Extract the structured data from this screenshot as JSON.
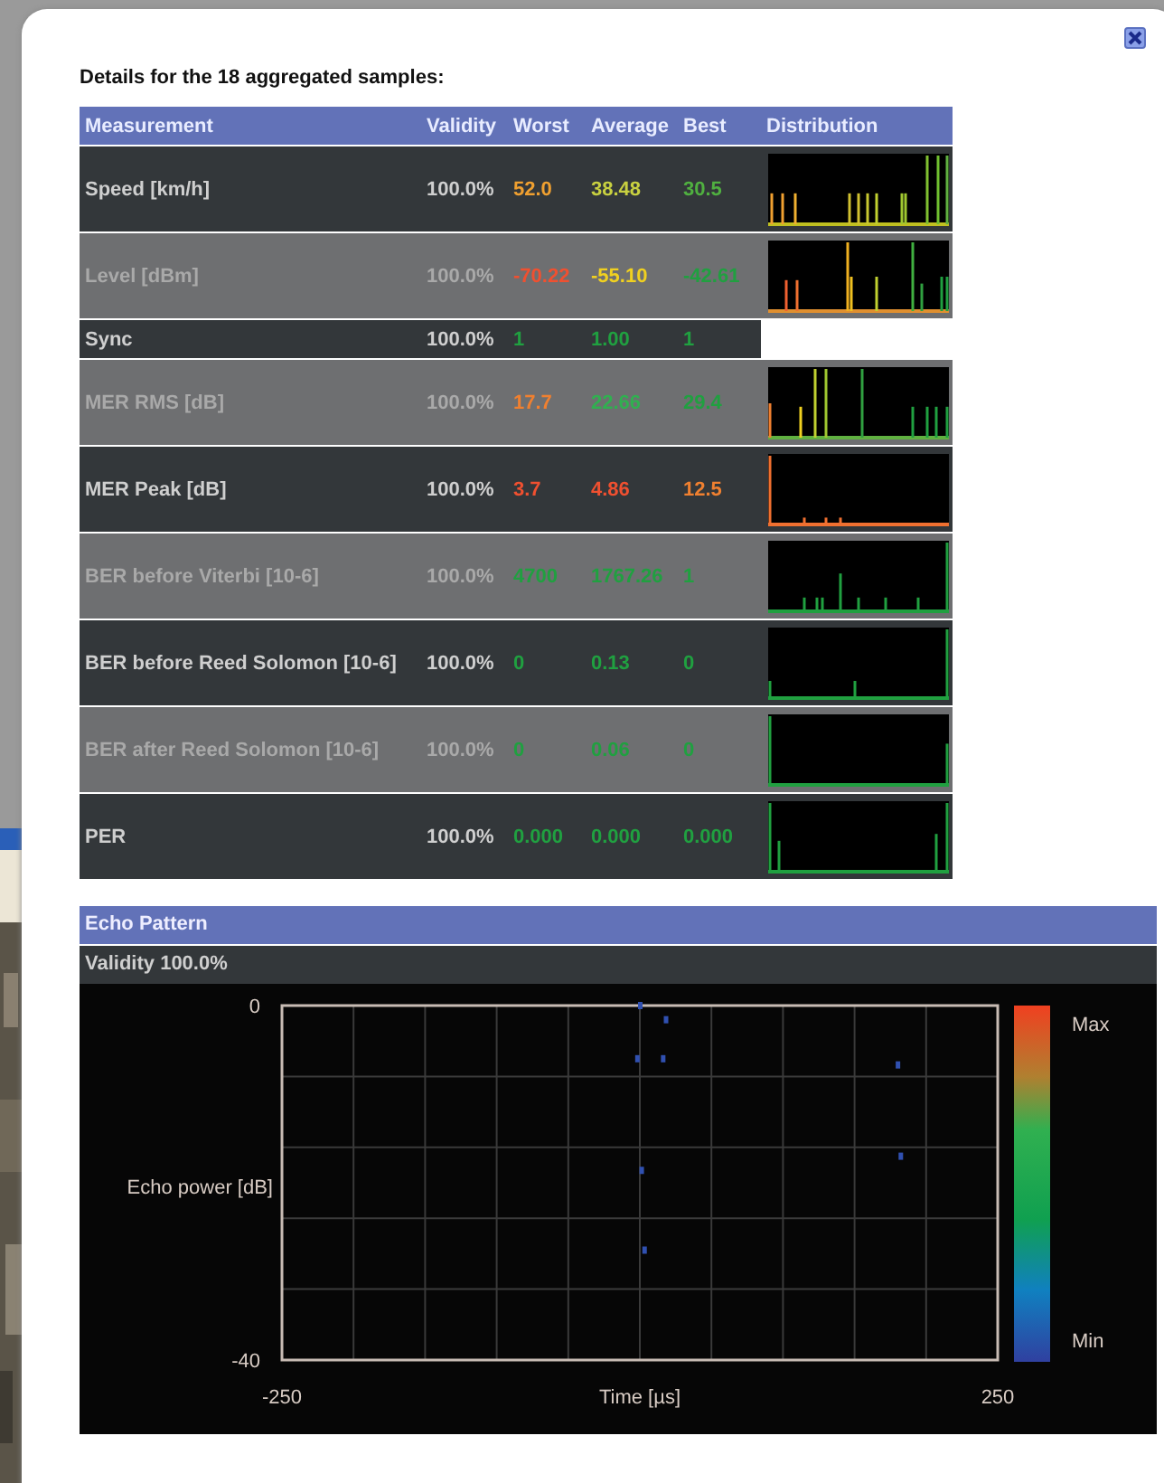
{
  "dialog": {
    "heading": "Details for the 18 aggregated samples:"
  },
  "table": {
    "columns": [
      "Measurement",
      "Validity",
      "Worst",
      "Average",
      "Best",
      "Distribution"
    ],
    "rows": [
      {
        "label": "Speed [km/h]",
        "validity": "100.0%",
        "worst": {
          "text": "52.0",
          "color": "#f0a030"
        },
        "average": {
          "text": "38.48",
          "color": "#c8d040"
        },
        "best": {
          "text": "30.5",
          "color": "#50b040"
        },
        "distribution": true
      },
      {
        "label": "Level [dBm]",
        "validity": "100.0%",
        "worst": {
          "text": "-70.22",
          "color": "#f05030"
        },
        "average": {
          "text": "-55.10",
          "color": "#f0d020"
        },
        "best": {
          "text": "-42.61",
          "color": "#20a040"
        },
        "distribution": true
      },
      {
        "label": "Sync",
        "validity": "100.0%",
        "worst": {
          "text": "1",
          "color": "#20a040"
        },
        "average": {
          "text": "1.00",
          "color": "#20a040"
        },
        "best": {
          "text": "1",
          "color": "#20a040"
        },
        "distribution": false
      },
      {
        "label": "MER RMS [dB]",
        "validity": "100.0%",
        "worst": {
          "text": "17.7",
          "color": "#f08030"
        },
        "average": {
          "text": "22.66",
          "color": "#30b050"
        },
        "best": {
          "text": "29.4",
          "color": "#20a040"
        },
        "distribution": true
      },
      {
        "label": "MER Peak [dB]",
        "validity": "100.0%",
        "worst": {
          "text": "3.7",
          "color": "#f05030"
        },
        "average": {
          "text": "4.86",
          "color": "#f05030"
        },
        "best": {
          "text": "12.5",
          "color": "#f08030"
        },
        "distribution": true
      },
      {
        "label": "BER before Viterbi [10-6]",
        "validity": "100.0%",
        "worst": {
          "text": "4700",
          "color": "#20a040"
        },
        "average": {
          "text": "1767.26",
          "color": "#20a040"
        },
        "best": {
          "text": "1",
          "color": "#20a040"
        },
        "distribution": true
      },
      {
        "label": "BER before Reed Solomon [10-6]",
        "validity": "100.0%",
        "worst": {
          "text": "0",
          "color": "#20a040"
        },
        "average": {
          "text": "0.13",
          "color": "#20a040"
        },
        "best": {
          "text": "0",
          "color": "#20a040"
        },
        "distribution": true
      },
      {
        "label": "BER after Reed Solomon [10-6]",
        "validity": "100.0%",
        "worst": {
          "text": "0",
          "color": "#20a040"
        },
        "average": {
          "text": "0.06",
          "color": "#20a040"
        },
        "best": {
          "text": "0",
          "color": "#20a040"
        },
        "distribution": true
      },
      {
        "label": "PER",
        "validity": "100.0%",
        "worst": {
          "text": "0.000",
          "color": "#20a040"
        },
        "average": {
          "text": "0.000",
          "color": "#20a040"
        },
        "best": {
          "text": "0.000",
          "color": "#20a040"
        },
        "distribution": true
      }
    ]
  },
  "echo_pattern": {
    "title": "Echo Pattern",
    "validity": "Validity 100.0%",
    "colorbar": {
      "max_label": "Max",
      "min_label": "Min"
    },
    "chart_data": {
      "type": "scatter",
      "xlabel": "Time [µs]",
      "ylabel": "Echo power [dB]",
      "x": [
        -2,
        0,
        1,
        3,
        16,
        18,
        180,
        182
      ],
      "series": [
        {
          "color": "#3050b0",
          "values": [
            -6,
            0,
            -18.6,
            -27.6,
            -6,
            -1.6,
            -6.7,
            -17
          ]
        }
      ],
      "xlim": [
        -250,
        250
      ],
      "ylim": [
        -40,
        0
      ],
      "xticks": [
        -250,
        250
      ],
      "yticks": [
        -40,
        0
      ]
    }
  }
}
